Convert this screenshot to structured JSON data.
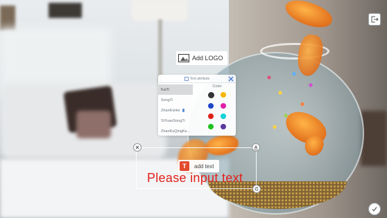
{
  "logo": {
    "label": "Add LOGO",
    "icon": "image-icon"
  },
  "text_attribute_panel": {
    "title": "Text attribute",
    "fonts": [
      "KaiTi",
      "SongTi",
      "ZhanKuHei",
      "SiYuanSongTi",
      "ZhanKuQingKe..."
    ],
    "selected_font": "KaiTi",
    "color_label": "Color",
    "colors": [
      "#333333",
      "#f5b800",
      "#1f47c9",
      "#e01fa5",
      "#e0201a",
      "#13d3d8",
      "#1fc21f",
      "#5a3a9e"
    ]
  },
  "text_box": {
    "add_text_label": "add text",
    "add_text_icon_letter": "T",
    "placeholder": "Please input text",
    "placeholder_color": "#e0201a",
    "handles": [
      "close-icon",
      "text-style-icon",
      "rotate-icon"
    ]
  },
  "toolbar": {
    "export_icon": "export-icon",
    "confirm_icon": "check-icon"
  }
}
